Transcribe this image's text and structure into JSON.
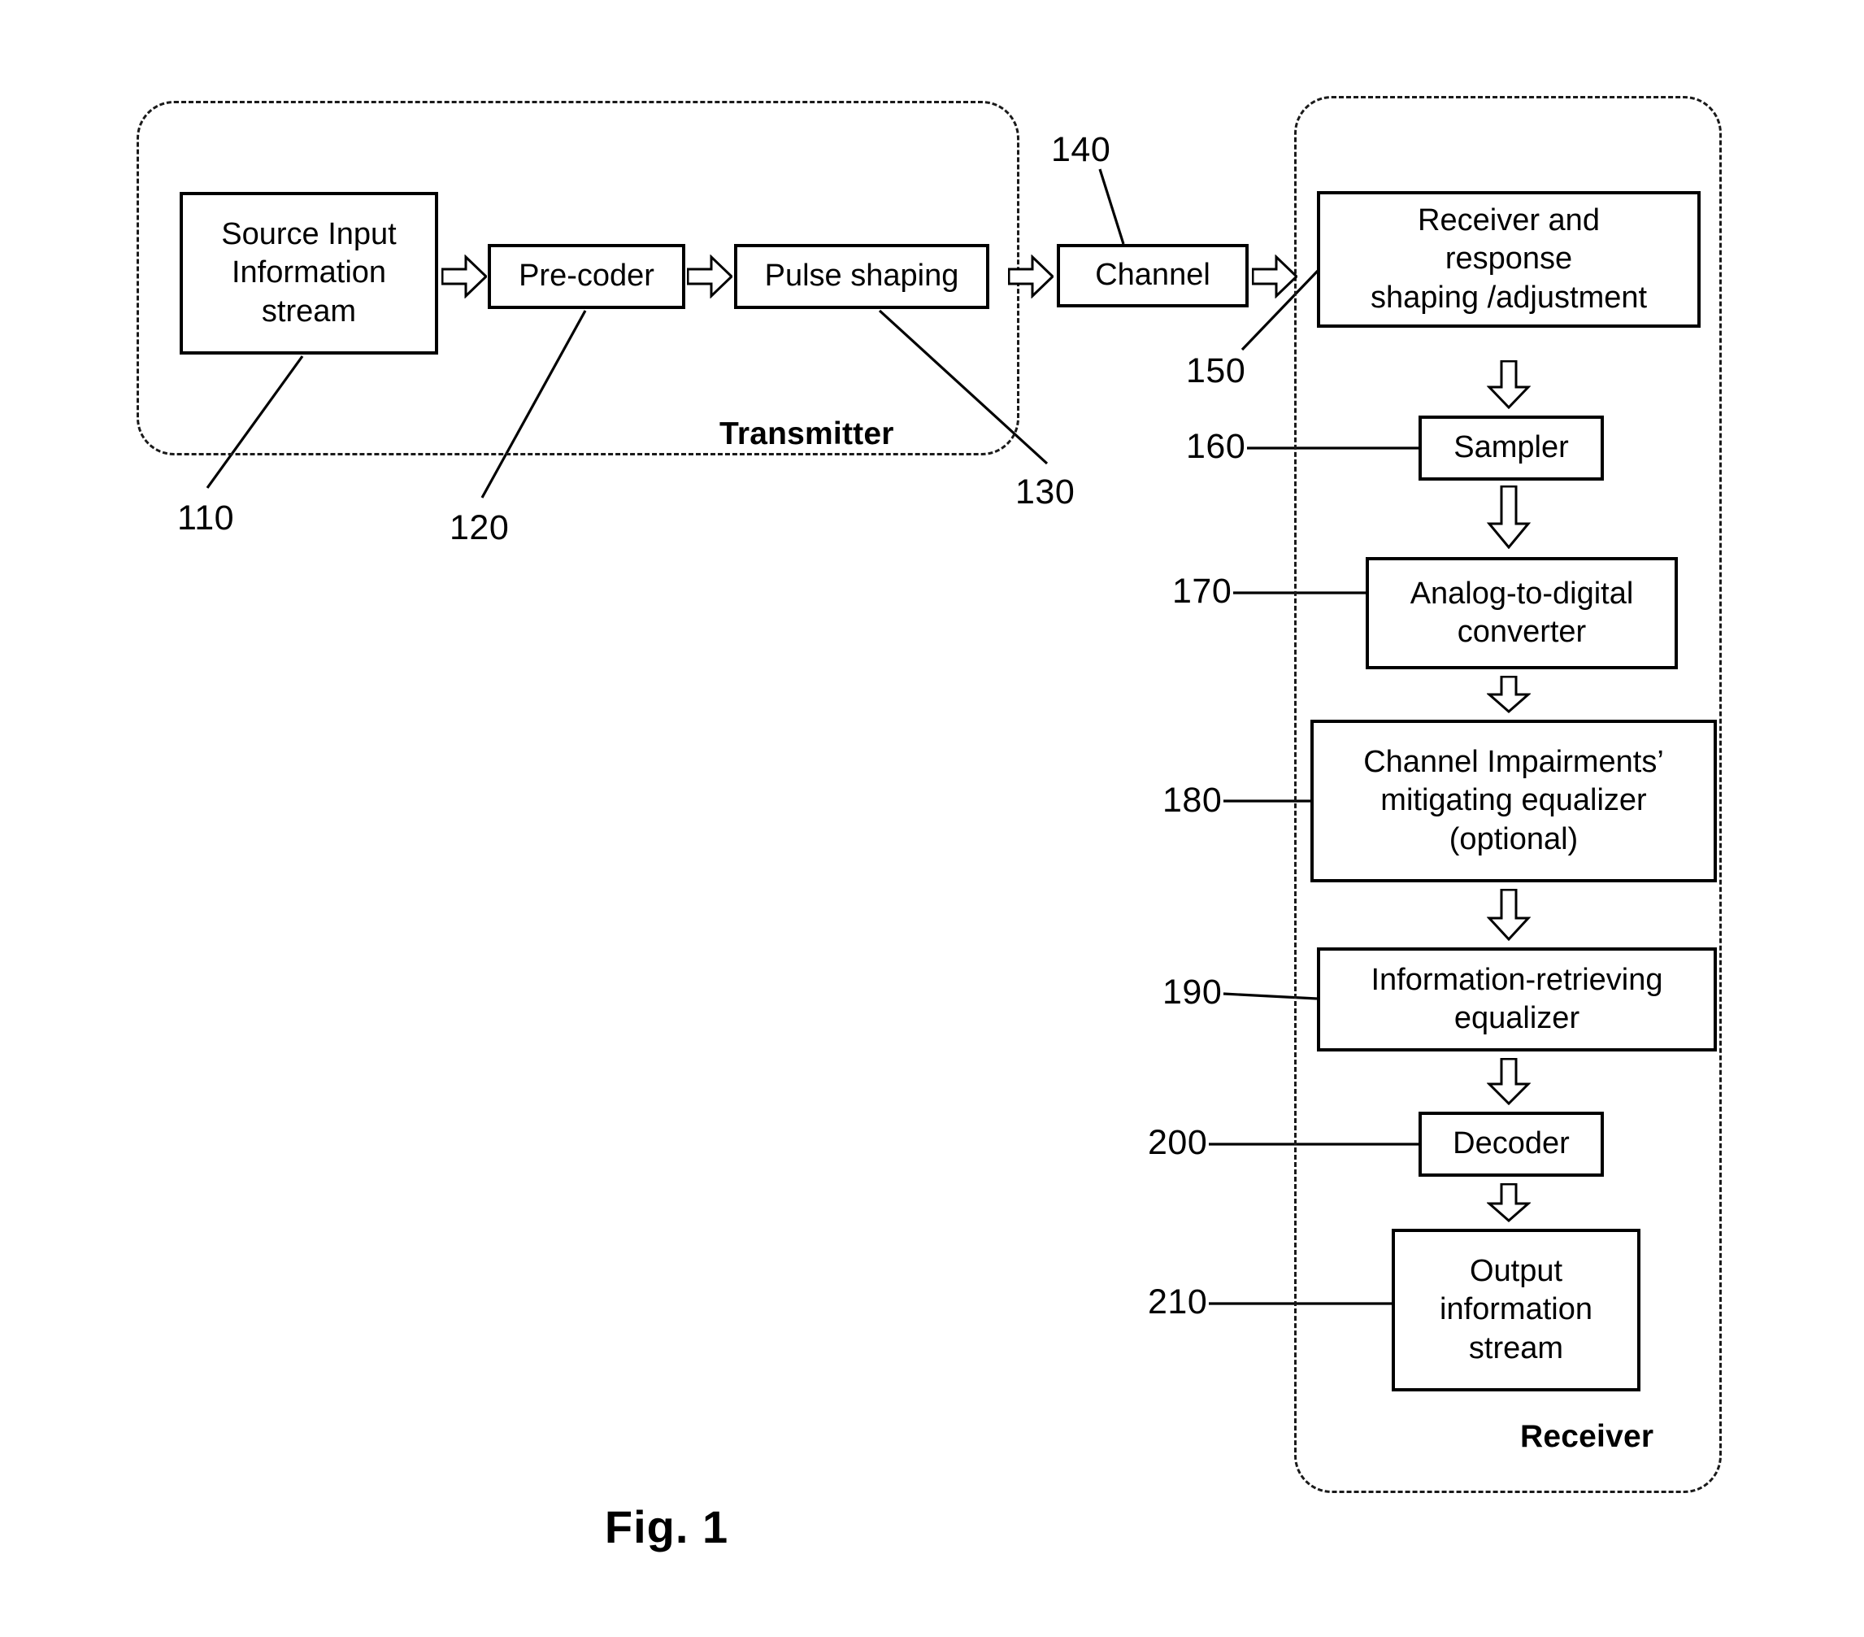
{
  "figure": {
    "caption": "Fig. 1"
  },
  "groups": {
    "transmitter": {
      "label": "Transmitter"
    },
    "receiver": {
      "label": "Receiver"
    }
  },
  "transmitter_chain": {
    "source": "Source Input Information stream",
    "source_lines": [
      "Source Input",
      "Information",
      "stream"
    ],
    "precoder": "Pre-coder",
    "pulse_shaping": "Pulse shaping"
  },
  "channel": {
    "label": "Channel"
  },
  "receiver_chain": {
    "receiver_shaping": "Receiver and response shaping /adjustment",
    "receiver_shaping_lines": [
      "Receiver and",
      "response",
      "shaping /adjustment"
    ],
    "sampler": "Sampler",
    "adc": "Analog-to-digital converter",
    "adc_lines": [
      "Analog-to-digital",
      "converter"
    ],
    "channel_impairments": "Channel Impairments’ mitigating equalizer (optional)",
    "channel_impairments_lines": [
      "Channel Impairments’",
      "mitigating equalizer",
      "(optional)"
    ],
    "info_retrieving": "Information-retrieving equalizer",
    "info_retrieving_lines": [
      "Information-retrieving",
      "equalizer"
    ],
    "decoder": "Decoder",
    "output": "Output information stream",
    "output_lines": [
      "Output",
      "information",
      "stream"
    ]
  },
  "reference_numerals": {
    "n110": "110",
    "n120": "120",
    "n130": "130",
    "n140": "140",
    "n150": "150",
    "n160": "160",
    "n170": "170",
    "n180": "180",
    "n190": "190",
    "n200": "200",
    "n210": "210"
  },
  "colors": {
    "stroke": "#000000",
    "background": "#ffffff"
  }
}
